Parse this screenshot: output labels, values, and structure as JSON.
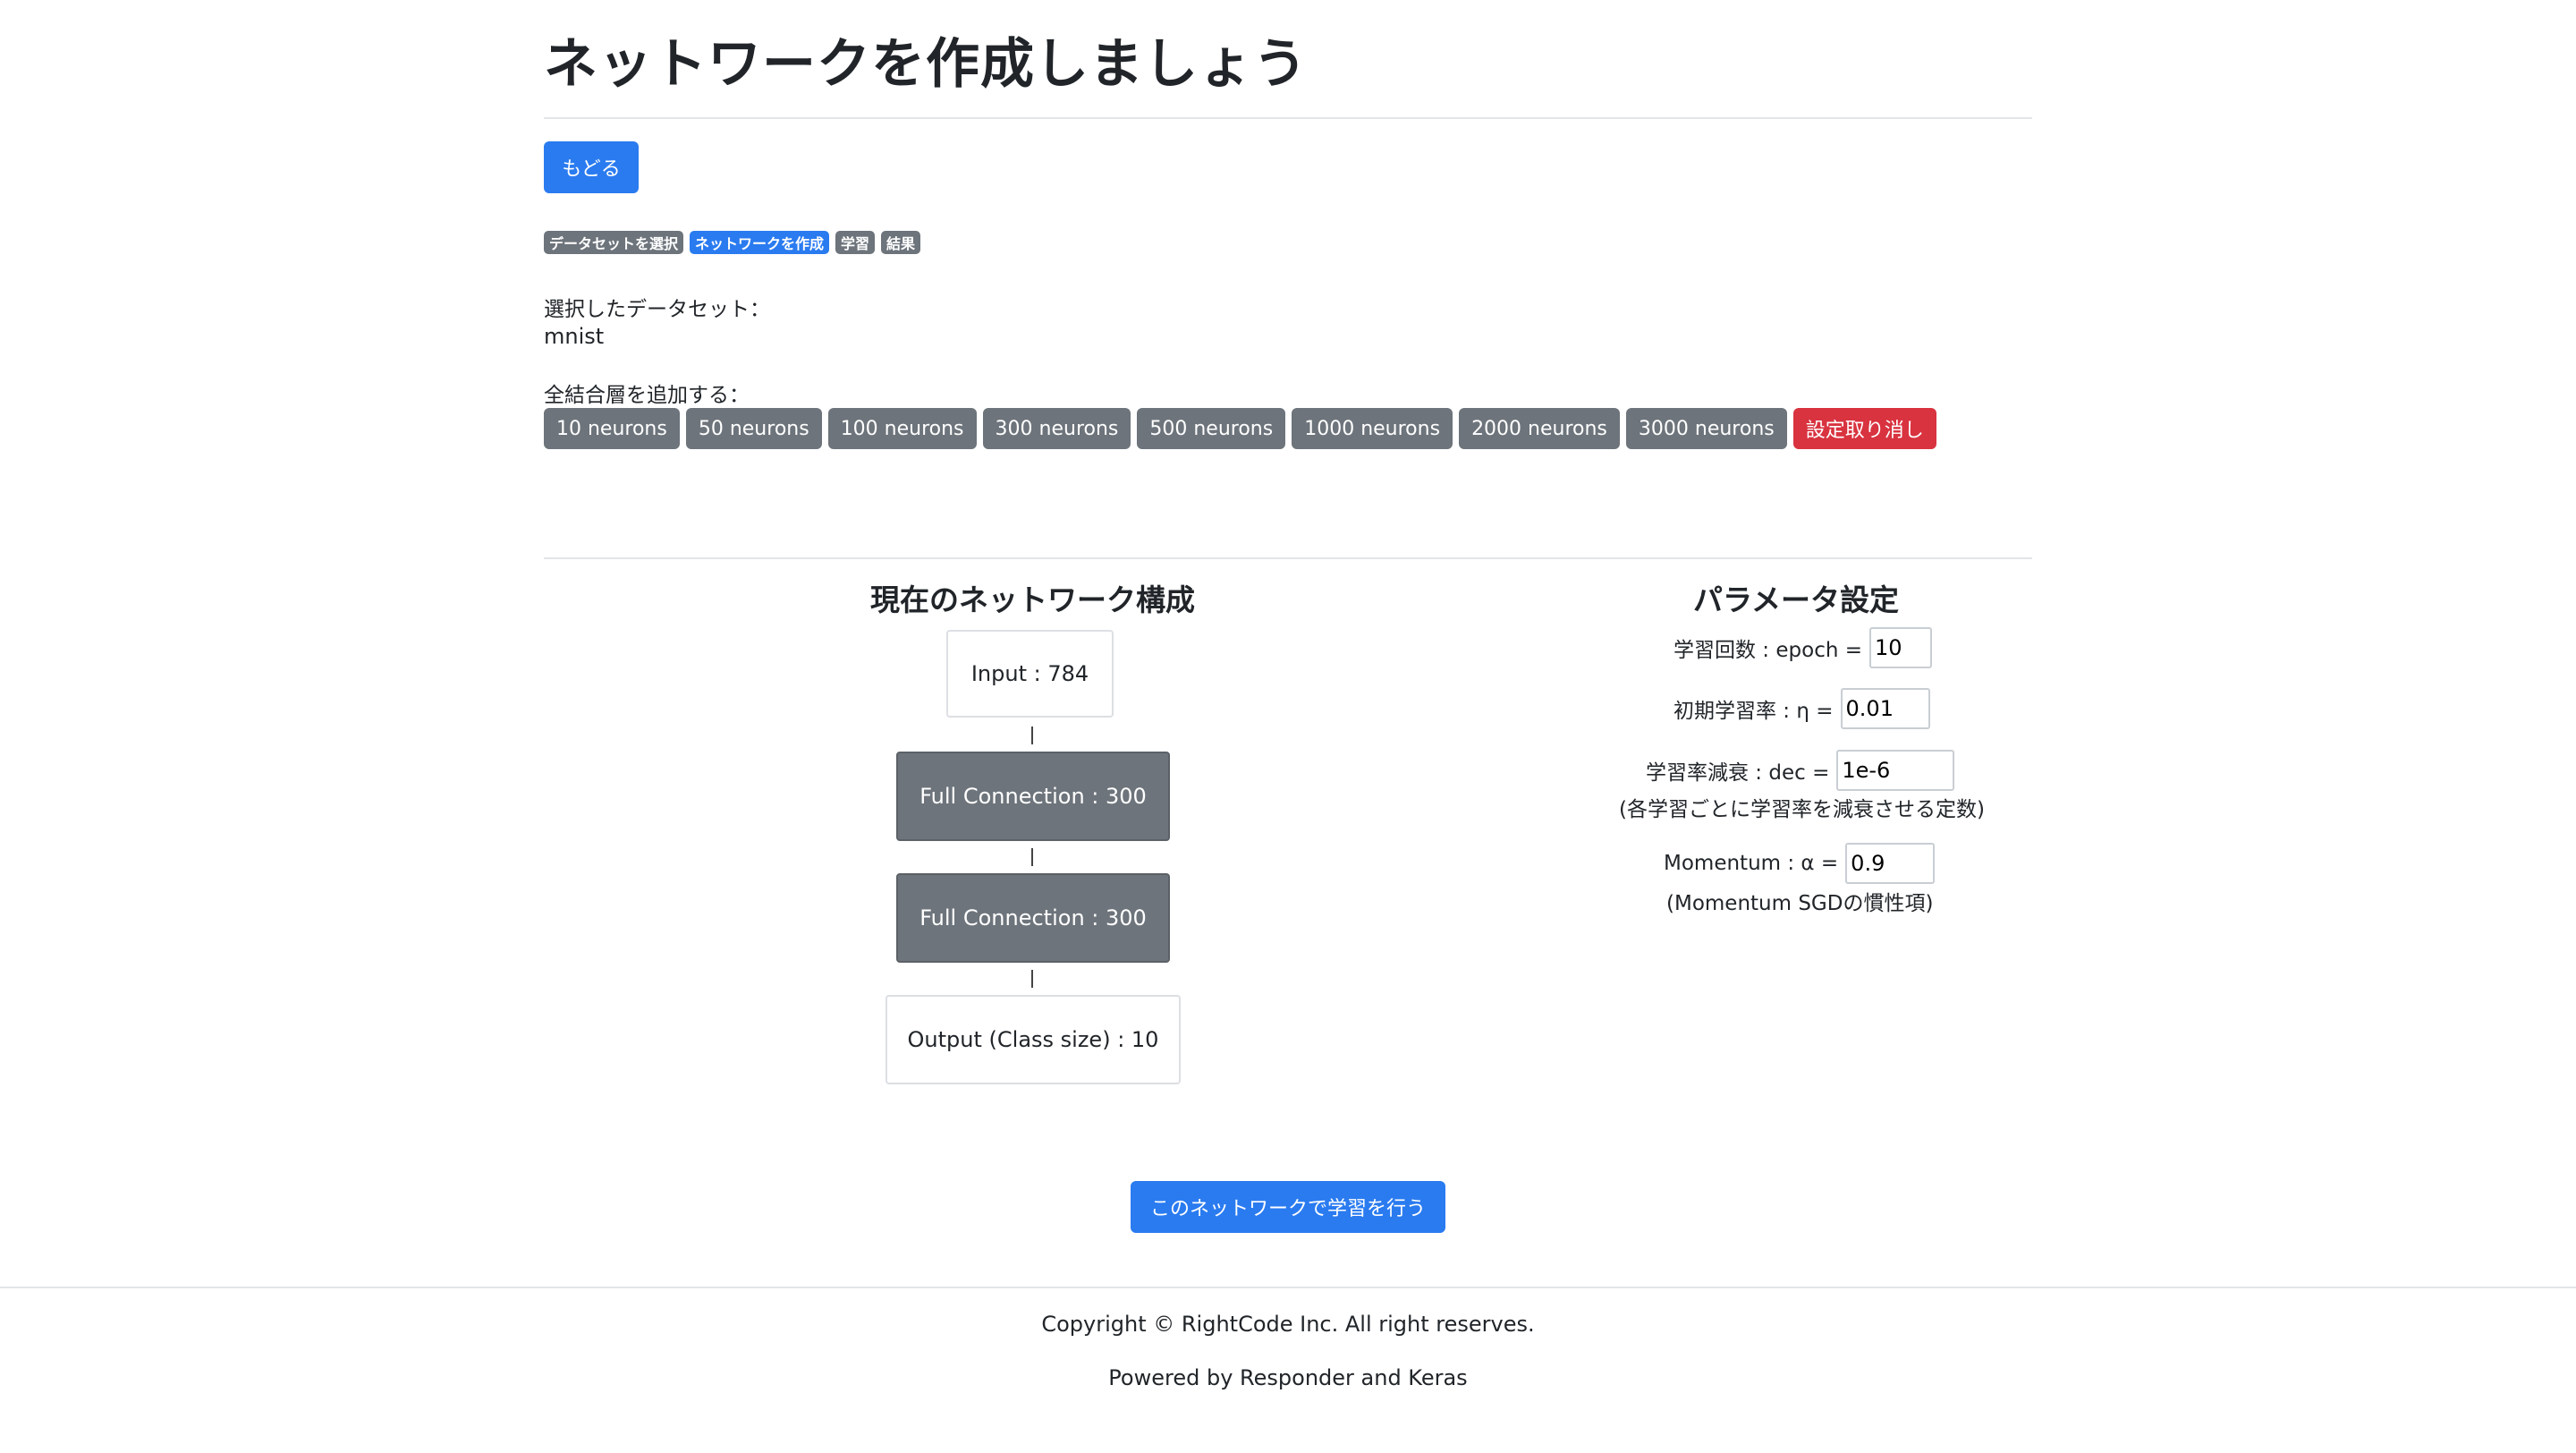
{
  "page": {
    "title": "ネットワークを作成しましょう",
    "back_button": "もどる"
  },
  "steps": [
    {
      "label": "データセットを選択",
      "active": false
    },
    {
      "label": "ネットワークを作成",
      "active": true
    },
    {
      "label": "学習",
      "active": false
    },
    {
      "label": "結果",
      "active": false
    }
  ],
  "dataset": {
    "label": "選択したデータセット：",
    "value": "mnist"
  },
  "add_layer": {
    "label": "全結合層を追加する：",
    "buttons": [
      "10 neurons",
      "50 neurons",
      "100 neurons",
      "300 neurons",
      "500 neurons",
      "1000 neurons",
      "2000 neurons",
      "3000 neurons"
    ],
    "reset_button": "設定取り消し"
  },
  "network": {
    "heading": "現在のネットワーク構成",
    "input_layer": "Input : 784",
    "hidden_layers": [
      "Full Connection : 300",
      "Full Connection : 300"
    ],
    "output_layer": "Output (Class size) : 10"
  },
  "params": {
    "heading": "パラメータ設定",
    "epoch": {
      "label": "学習回数 : epoch =",
      "value": "10"
    },
    "lr": {
      "label": "初期学習率 : η =",
      "value": "0.01"
    },
    "decay": {
      "label": "学習率減衰 : dec =",
      "value": "1e-6",
      "note": "(各学習ごとに学習率を減衰させる定数)"
    },
    "momentum": {
      "label": "Momentum : α =",
      "value": "0.9",
      "note": "(Momentum SGDの慣性項)"
    }
  },
  "train_button": "このネットワークで学習を行う",
  "footer": {
    "copyright": "Copyright © RightCode Inc. All right reserves.",
    "powered": "Powered by Responder and Keras"
  },
  "colors": {
    "primary": "#2a7bf0",
    "secondary": "#6d747b",
    "danger": "#d8333f"
  }
}
